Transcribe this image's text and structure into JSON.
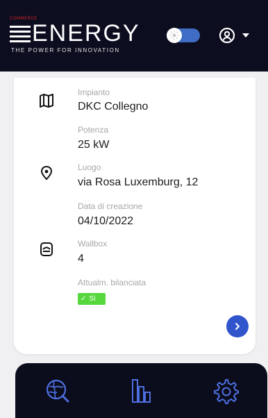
{
  "header": {
    "logo_small": "COMMERCE",
    "logo_text": "ENERGY",
    "tagline": "THE POWER FOR INNOVATION",
    "theme_toggle_icon": "sun-icon",
    "user_icon": "user-circle-icon"
  },
  "details": {
    "impianto_label": "Impianto",
    "impianto_value": "DKC Collegno",
    "potenza_label": "Potenza",
    "potenza_value": "25 kW",
    "luogo_label": "Luogo",
    "luogo_value": "via Rosa Luxemburg, 12",
    "data_label": "Data di creazione",
    "data_value": "04/10/2022",
    "wallbox_label": "Wallbox",
    "wallbox_value": "4",
    "bilanciata_label": "Attualm. bilanciata",
    "bilanciata_value": "Sì"
  },
  "nav": {
    "items": [
      "globe-search-icon",
      "bar-chart-icon",
      "settings-gear-icon"
    ]
  },
  "colors": {
    "header_bg": "#0c0d1f",
    "accent_blue": "#2f54cc",
    "nav_icon": "#4d6fe0",
    "badge_green": "#56d83d"
  }
}
